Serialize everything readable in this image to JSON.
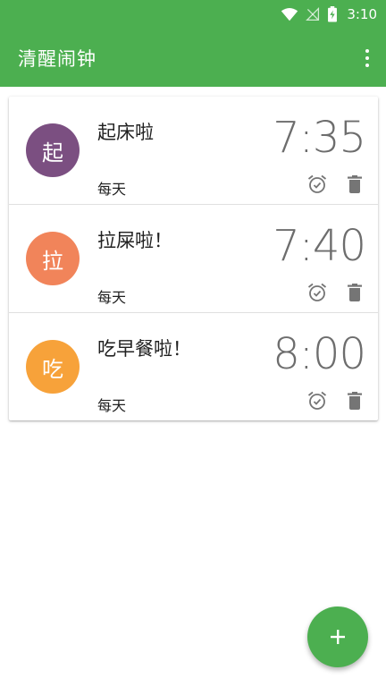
{
  "status_bar": {
    "time": "3:10",
    "icons": [
      "wifi-icon",
      "no-signal-icon",
      "battery-charging-icon"
    ]
  },
  "app_bar": {
    "title": "清醒闹钟",
    "menu_icon": "more-vert-icon"
  },
  "alarms": [
    {
      "avatar": "起",
      "avatar_color": "#7b4f81",
      "label": "起床啦",
      "time": "7:35",
      "repeat": "每天",
      "alarm_icon": "alarm-check-icon",
      "delete_icon": "delete-icon"
    },
    {
      "avatar": "拉",
      "avatar_color": "#f1845a",
      "label": "拉屎啦！",
      "time": "7:40",
      "repeat": "每天",
      "alarm_icon": "alarm-check-icon",
      "delete_icon": "delete-icon"
    },
    {
      "avatar": "吃",
      "avatar_color": "#f7a23a",
      "label": "吃早餐啦！",
      "time": "8:00",
      "repeat": "每天",
      "alarm_icon": "alarm-check-icon",
      "delete_icon": "delete-icon"
    }
  ],
  "fab": {
    "icon": "add-icon",
    "color": "#4caf50"
  },
  "colors": {
    "primary": "#4caf50",
    "text_primary": "#212121",
    "time_text": "#6d6d6d",
    "icon_gray": "#757575"
  }
}
